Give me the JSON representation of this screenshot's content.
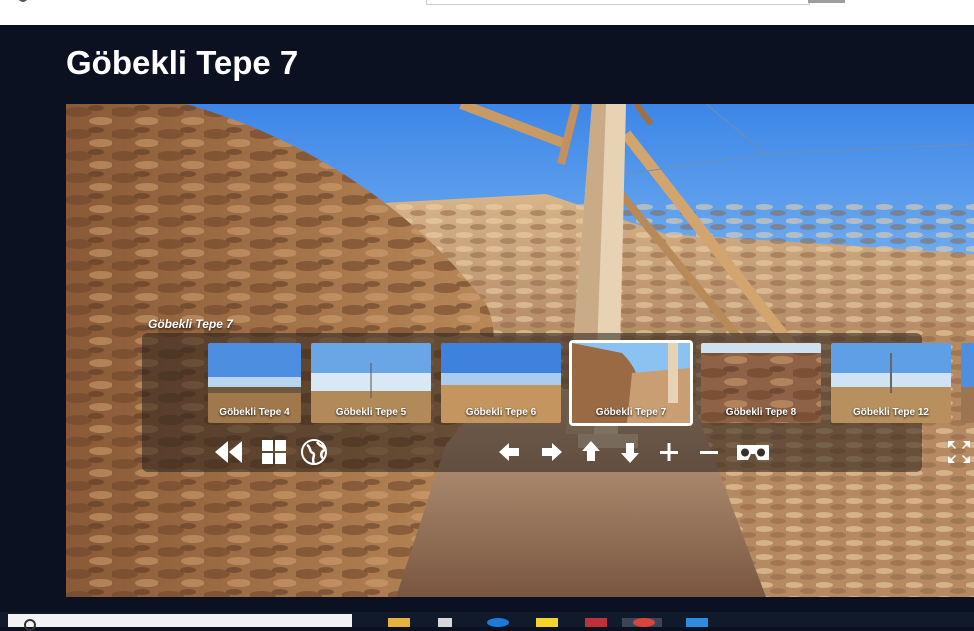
{
  "page": {
    "title": "Göbekli Tepe 7"
  },
  "tour": {
    "current_label": "Göbekli Tepe 7",
    "thumbnails": [
      {
        "label": "Göbekli Tepe 4",
        "active": false
      },
      {
        "label": "Göbekli Tepe 5",
        "active": false
      },
      {
        "label": "Göbekli Tepe 6",
        "active": false
      },
      {
        "label": "Göbekli Tepe 7",
        "active": true
      },
      {
        "label": "Göbekli Tepe 8",
        "active": false
      },
      {
        "label": "Göbekli Tepe 12",
        "active": false
      }
    ]
  },
  "controls": {
    "left": [
      "rewind-icon",
      "thumbnails-grid-icon",
      "globe-icon"
    ],
    "center": [
      "arrow-left-icon",
      "arrow-right-icon",
      "arrow-up-icon",
      "arrow-down-icon",
      "zoom-in-icon",
      "zoom-out-icon",
      "vr-headset-icon"
    ],
    "right": [
      "fullscreen-icon"
    ]
  },
  "colors": {
    "page_background": "#0b1120",
    "title_text": "#ffffff",
    "active_thumb_border": "#ffffff"
  }
}
